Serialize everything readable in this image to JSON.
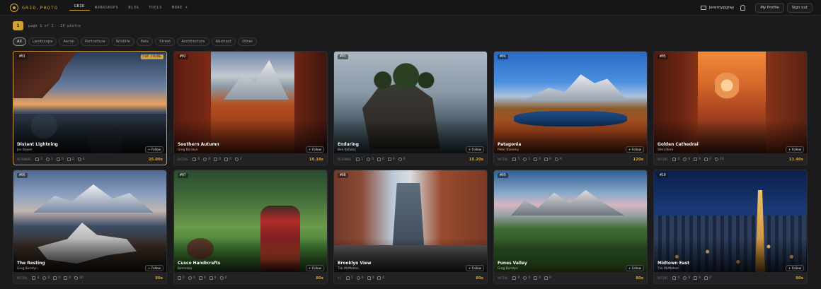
{
  "app": {
    "logo_text": "GRID.PHOTO",
    "nav": [
      "GRID",
      "WORKSHOPS",
      "BLOG",
      "TOOLS",
      "MORE +"
    ],
    "active_nav_index": 0,
    "user_name": "jeremypgray",
    "my_profile_label": "My Profile",
    "sign_out_label": "Sign out"
  },
  "pager": {
    "current_page": "1",
    "text": "page 1 of 1 · 10 photos"
  },
  "filters": [
    "All",
    "Landscape",
    "Aerial",
    "Portraiture",
    "Wildlife",
    "Pets",
    "Street",
    "Architecture",
    "Abstract",
    "Other"
  ],
  "active_filter": "All",
  "cards": [
    {
      "num": "#01",
      "badge": "TOP FRAME",
      "title": "Distant Lightning",
      "author": "Jon Bower",
      "pid": "PETRONUS",
      "stats": [
        "2",
        "1",
        "0",
        "0",
        "4"
      ],
      "time": "25.00s",
      "follow": "+ Follow"
    },
    {
      "num": "#02",
      "badge": "",
      "title": "Southern Autumn",
      "author": "Greg Boratyn",
      "pid": "RATIOS",
      "stats": [
        "0",
        "0",
        "0",
        "0",
        "2"
      ],
      "time": "10.18s",
      "follow": "+ Follow"
    },
    {
      "num": "#03",
      "badge": "",
      "title": "Enduring",
      "author": "Ben Kaliwas",
      "pid": "PETRONUS",
      "stats": [
        "1",
        "0",
        "0",
        "0",
        "0"
      ],
      "time": "15.20s",
      "follow": "+ Follow"
    },
    {
      "num": "#04",
      "badge": "",
      "title": "Patagonia",
      "author": "Peter Kameny",
      "pid": "RATIOS",
      "stats": [
        "5",
        "1",
        "0",
        "0",
        "0"
      ],
      "time": "120s",
      "follow": "+ Follow"
    },
    {
      "num": "#05",
      "badge": "",
      "title": "Golden Cathedral",
      "author": "Stervidere",
      "pid": "RATIOS",
      "stats": [
        "0",
        "0",
        "0",
        "0",
        "10"
      ],
      "time": "11.40s",
      "follow": "+ Follow"
    },
    {
      "num": "#06",
      "badge": "",
      "title": "The Resting",
      "author": "Greg Boratyn",
      "pid": "RATIOS",
      "stats": [
        "4",
        "0",
        "0",
        "0",
        "10"
      ],
      "time": "80s",
      "follow": "+ Follow"
    },
    {
      "num": "#07",
      "badge": "",
      "title": "Cusco Handicrafts",
      "author": "Bernanke",
      "pid": "",
      "stats": [
        "0",
        "0",
        "0",
        "0",
        "0"
      ],
      "time": "80s",
      "follow": "+ Follow"
    },
    {
      "num": "#08",
      "badge": "",
      "title": "Brooklyn View",
      "author": "Tim McMahon",
      "pid": "41",
      "stats": [
        "1",
        "0",
        "0",
        "0",
        ""
      ],
      "time": "80s",
      "follow": "+ Follow"
    },
    {
      "num": "#09",
      "badge": "",
      "title": "Funes Valley",
      "author": "Greg Boratyn",
      "pid": "RATIOS",
      "stats": [
        "0",
        "0",
        "0",
        "0",
        ""
      ],
      "time": "80s",
      "follow": "+ Follow"
    },
    {
      "num": "#10",
      "badge": "",
      "title": "Midtown East",
      "author": "Tim McMahon",
      "pid": "RATIOS",
      "stats": [
        "0",
        "0",
        "0",
        "0",
        ""
      ],
      "time": "80s",
      "follow": "+ Follow"
    }
  ],
  "colors": {
    "accent": "#d2a23a",
    "background": "#1b1b1d",
    "card": "#222224"
  }
}
